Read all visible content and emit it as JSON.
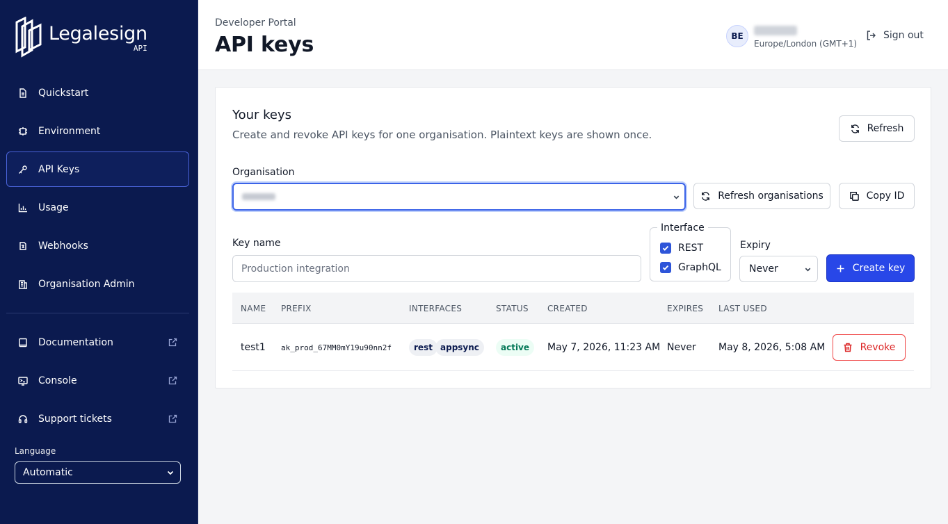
{
  "brand": {
    "name": "Legalesign",
    "sub": "API"
  },
  "sidebar": {
    "items": [
      {
        "label": "Quickstart",
        "icon": "document-icon"
      },
      {
        "label": "Environment",
        "icon": "server-icon"
      },
      {
        "label": "API Keys",
        "icon": "key-icon",
        "active": true
      },
      {
        "label": "Usage",
        "icon": "bar-chart-icon"
      },
      {
        "label": "Webhooks",
        "icon": "webhook-icon"
      },
      {
        "label": "Organisation Admin",
        "icon": "building-icon"
      }
    ],
    "external": [
      {
        "label": "Documentation",
        "icon": "book-icon"
      },
      {
        "label": "Console",
        "icon": "terminal-icon"
      },
      {
        "label": "Support tickets",
        "icon": "headset-icon"
      }
    ],
    "language_label": "Language",
    "language_value": "Automatic"
  },
  "header": {
    "breadcrumb": "Developer Portal",
    "title": "API keys",
    "user_initials": "BE",
    "user_timezone": "Europe/London (GMT+1)",
    "sign_out": "Sign out"
  },
  "card": {
    "title": "Your keys",
    "subtitle": "Create and revoke API keys for one organisation. Plaintext keys are shown once.",
    "refresh_label": "Refresh",
    "organisation_label": "Organisation",
    "refresh_orgs_label": "Refresh organisations",
    "copy_id_label": "Copy ID",
    "key_name_label": "Key name",
    "key_name_placeholder": "Production integration",
    "interface_label": "Interface",
    "interfaces": [
      {
        "label": "REST",
        "checked": true
      },
      {
        "label": "GraphQL",
        "checked": true
      }
    ],
    "expiry_label": "Expiry",
    "expiry_value": "Never",
    "create_label": "Create key"
  },
  "table": {
    "headers": [
      "NAME",
      "PREFIX",
      "INTERFACES",
      "STATUS",
      "CREATED",
      "EXPIRES",
      "LAST USED"
    ],
    "rows": [
      {
        "name": "test1",
        "prefix": "ak_prod_67MM0mY19u90nn2f",
        "interfaces": [
          "rest",
          "appsync"
        ],
        "status": "active",
        "created": "May 7, 2026, 11:23 AM",
        "expires": "Never",
        "last_used": "May 8, 2026, 5:08 AM",
        "action": "Revoke"
      }
    ]
  },
  "colors": {
    "sidebar_bg": "#0b1a4f",
    "primary": "#2847e8",
    "danger": "#dc2626",
    "success": "#047857"
  }
}
